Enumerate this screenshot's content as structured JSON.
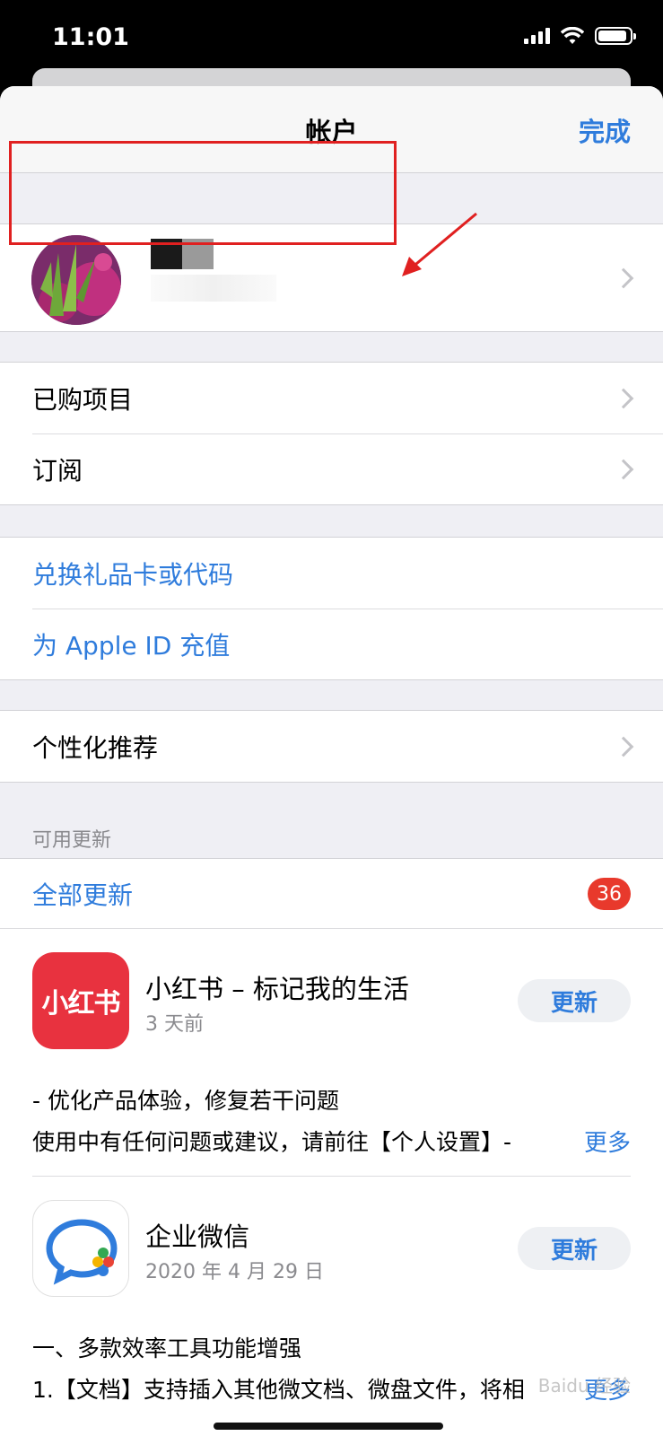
{
  "status_bar": {
    "time": "11:01",
    "battery_level": 0.9
  },
  "nav": {
    "title": "帐户",
    "done_label": "完成"
  },
  "menu": {
    "purchased": "已购项目",
    "subscriptions": "订阅",
    "redeem": "兑换礼品卡或代码",
    "add_funds": "为 Apple ID 充值",
    "personalized": "个性化推荐"
  },
  "updates": {
    "section_label": "可用更新",
    "update_all": "全部更新",
    "badge_count": "36",
    "apps": [
      {
        "name": "小红书 – 标记我的生活",
        "icon_text": "小红书",
        "date": "3 天前",
        "button": "更新",
        "note1": "- 优化产品体验，修复若干问题",
        "note2": "使用中有任何问题或建议，请前往【个人设置】-",
        "more": "更多"
      },
      {
        "name": "企业微信",
        "date": "2020 年 4 月 29 日",
        "button": "更新",
        "note1": "一、多款效率工具功能增强",
        "note2": "1.【文档】支持插入其他微文档、微盘文件，将相",
        "more": "更多"
      }
    ]
  },
  "watermark": "Baidu 经验",
  "colors": {
    "accent": "#2f7cdc",
    "badge": "#e8392c",
    "highlight": "#e02020"
  }
}
